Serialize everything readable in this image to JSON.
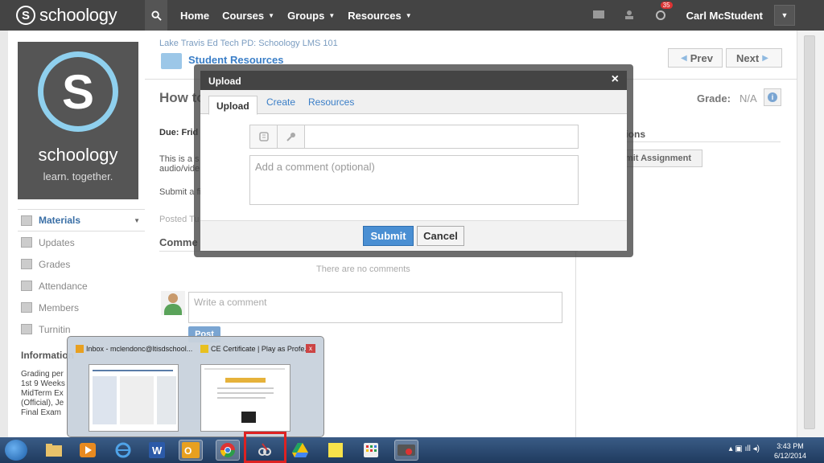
{
  "topbar": {
    "logo_letter": "S",
    "logo_text": "schoology",
    "nav": [
      "Home",
      "Courses",
      "Groups",
      "Resources"
    ],
    "notification_count": "35",
    "user_name": "Carl McStudent"
  },
  "sidebar": {
    "logo_letter": "S",
    "logo_name": "schoology",
    "logo_tagline": "learn. together.",
    "items": [
      "Materials",
      "Updates",
      "Grades",
      "Attendance",
      "Members",
      "Turnitin"
    ],
    "info_heading": "Information",
    "info_lines": [
      "Grading per",
      "1st 9 Weeks",
      "MidTerm Ex",
      "(Official), Je",
      "Final Exam"
    ]
  },
  "main": {
    "breadcrumb": "Lake Travis Ed Tech PD: Schoology LMS 101",
    "folder_title": "Student Resources",
    "prev_label": "Prev",
    "next_label": "Next",
    "assignment_title": "How to",
    "grade_label": "Grade:",
    "grade_value": "N/A",
    "due": "Due: Frid",
    "desc_line1": "This is a s",
    "desc_line2": "audio/vide",
    "desc_line3": "Submit a fi",
    "posted": "Posted Tu",
    "comments_heading": "Comme",
    "no_comments": "There are no comments",
    "comment_placeholder": "Write a comment",
    "post_label": "Post",
    "submissions_heading": "ssions",
    "submit_assignment_label": "mit Assignment"
  },
  "modal": {
    "title": "Upload",
    "close": "×",
    "tabs": [
      "Upload",
      "Create",
      "Resources"
    ],
    "comment_placeholder": "Add a comment (optional)",
    "submit_label": "Submit",
    "cancel_label": "Cancel"
  },
  "thumbnails": [
    {
      "title": "Inbox - mclendonc@ltisdschool..."
    },
    {
      "title": "CE Certificate | Play as Profe..."
    }
  ],
  "taskbar": {
    "time": "3:43 PM",
    "date": "6/12/2014"
  },
  "colors": {
    "topbar": "#444444",
    "accent": "#3a7ec7",
    "submit": "#4a8fd3",
    "highlight": "#dd2222"
  }
}
